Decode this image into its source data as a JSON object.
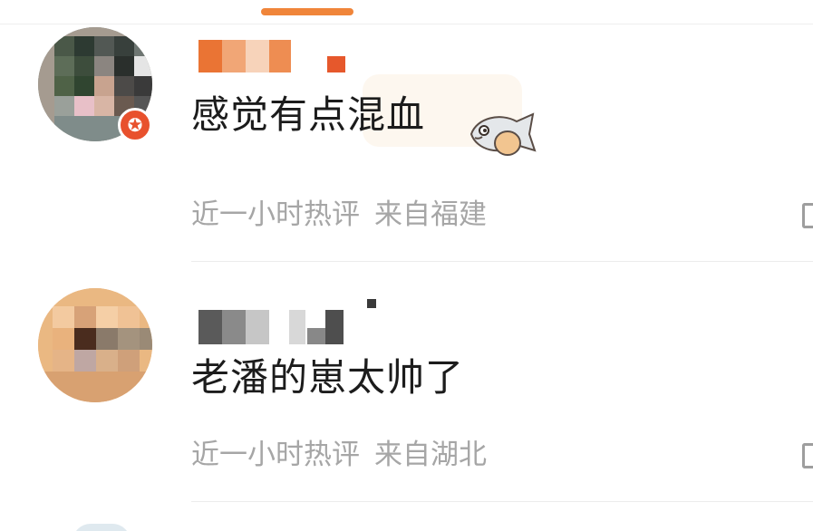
{
  "comments": [
    {
      "text": "感觉有点混血",
      "meta_time": "近一小时热评",
      "meta_region": "来自福建",
      "badge_icon": "star-icon",
      "sticker": "fish-sticker-icon"
    },
    {
      "text": "老潘的崽太帅了",
      "meta_time": "近一小时热评",
      "meta_region": "来自湖北"
    }
  ],
  "badge_glyph": "✪",
  "colors": {
    "accent": "#f0853a",
    "badge": "#e8512d",
    "meta_text": "#a6a6a6",
    "comment_text": "#1c1c1c"
  }
}
